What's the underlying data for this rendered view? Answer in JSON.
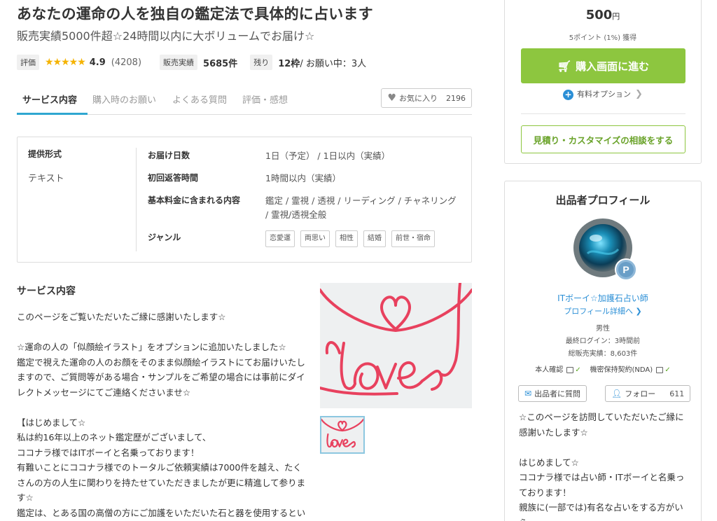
{
  "service": {
    "title": "あなたの運命の人を独自の鑑定法で具体的に占います",
    "subtitle": "販売実績5000件超☆24時間以内に大ボリュームでお届け☆"
  },
  "stats": {
    "rating_tag": "評価",
    "stars": "★★★★★",
    "rating": "4.9",
    "review_count": "(4208)",
    "sales_tag": "販売実績",
    "sales": "5685件",
    "remaining_tag": "残り",
    "remaining": "12枠",
    "in_progress": " / お願い中：3人"
  },
  "tabs": [
    {
      "label": "サービス内容"
    },
    {
      "label": "購入時のお願い"
    },
    {
      "label": "よくある質問"
    },
    {
      "label": "評価・感想"
    }
  ],
  "favorite": {
    "label": "お気に入り",
    "count": "2196",
    "icon": "heart-icon"
  },
  "info": {
    "format_label": "提供形式",
    "format_value": "テキスト",
    "delivery_label": "お届け日数",
    "delivery_value": "1日（予定） / 1日以内（実績）",
    "first_reply_label": "初回返答時間",
    "first_reply_value": "1時間以内（実績）",
    "included_label": "基本料金に含まれる内容",
    "included_value": "鑑定 / 霊視 / 透視 / リーディング / チャネリング / 霊視/透視全般",
    "genre_label": "ジャンル",
    "genres": [
      "恋愛運",
      "両思い",
      "相性",
      "結婚",
      "前世・宿命"
    ]
  },
  "description": {
    "title": "サービス内容",
    "text": "このページをご覧いただいたご縁に感謝いたします☆\n\n☆運命の人の「似顔絵イラスト」をオプションに追加いたしました☆\n鑑定で視えた運命の人のお顔をそのまま似顔絵イラストにてお届けいたしますので、ご質問等がある場合・サンプルをご希望の場合には事前にダイレクトメッセージにてご連絡くださいませ☆\n\n【はじめまして☆\n私は約16年以上のネット鑑定歴がございまして、\nココナラ様ではITボーイと名乗っております！\n有難いことにココナラ様でのトータルご依頼実績は7000件を越え、たくさんの方の人生に関わりを持たせていただきましたが更に精進して参ります☆\n鑑定は、とある国の高僧の方にご加護をいただいた石と器を使用するという珍しい手法を用いております☆】"
  },
  "purchase": {
    "price": "500",
    "currency": "円",
    "points": "5ポイント (1%) 獲得",
    "buy_label": "購入画面に進む",
    "option_label": "有料オプション",
    "consult_label": "見積り・カスタマイズの相談をする"
  },
  "profile": {
    "title": "出品者プロフィール",
    "name": "ITボーイ☆加護石占い師",
    "detail_link": "プロフィール詳細へ ❯",
    "gender": "男性",
    "last_login": "最終ログイン：3時間前",
    "total_sales": "総販売実績：8,603件",
    "id_verify_label": "本人確認",
    "nda_label": "機密保持契約(NDA)",
    "ask_label": "出品者に質問",
    "follow_label": "フォロー",
    "follow_count": "611",
    "intro": "☆このページを訪問していただいたご縁に感謝いたします☆\n\nはじめまして☆\nココナラ様では占い師・ITボーイと名乗っております！\n親族に(一部では)有名な占いをする方がいらっ..."
  },
  "colors": {
    "accent_blue": "#2fa7d1",
    "buy_green": "#8dc63f",
    "star_gold": "#f5b300",
    "link_blue": "#2b8fd6",
    "wire_red": "#e8415e"
  }
}
